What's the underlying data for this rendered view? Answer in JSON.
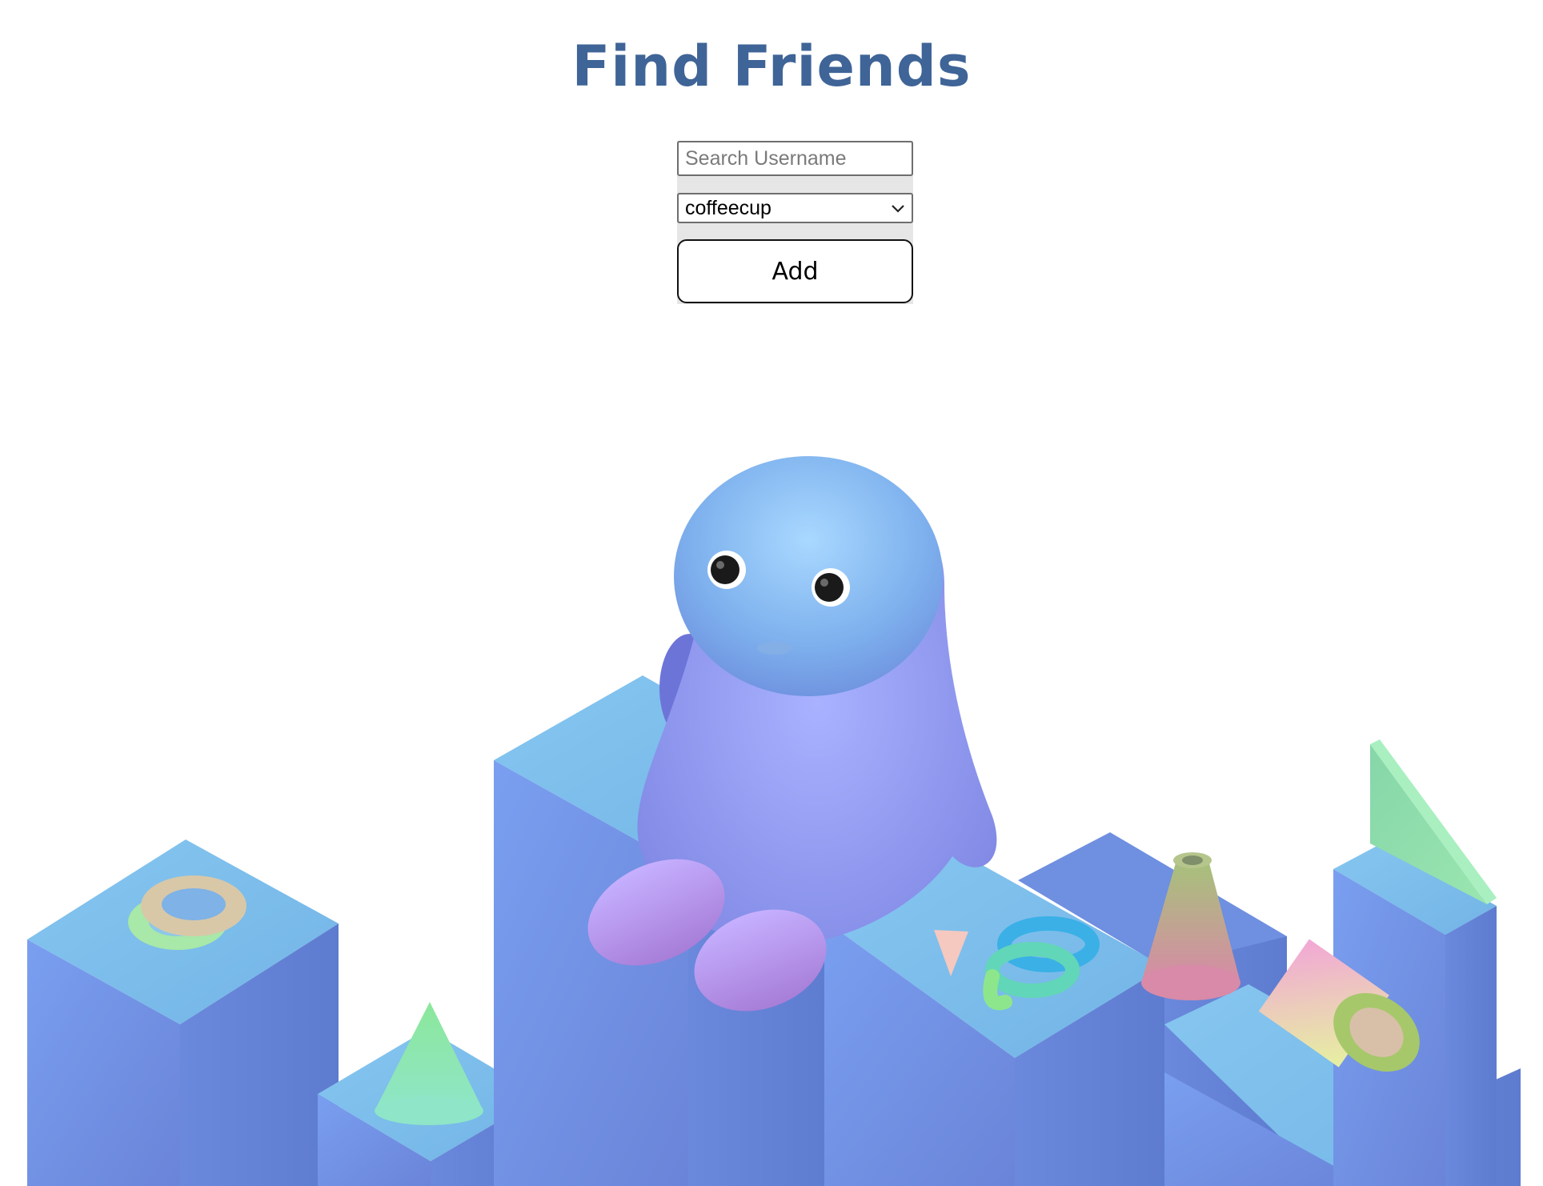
{
  "page": {
    "title": "Find Friends",
    "title_color": "#3f6497"
  },
  "form": {
    "search_placeholder": "Search Username",
    "search_value": "",
    "selected_user": "coffeecup",
    "add_label": "Add"
  },
  "colors": {
    "block_blue": "#7394ec",
    "block_top": "#78bde9",
    "character_blue": "#7fb2ee"
  },
  "icons": {
    "select_chevron": "chevron-down-icon"
  }
}
